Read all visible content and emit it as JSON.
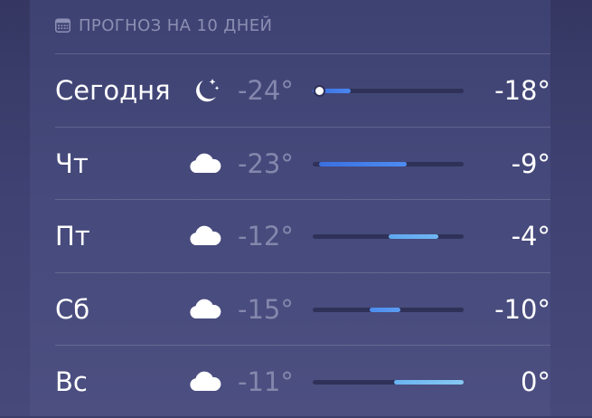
{
  "header": {
    "icon": "calendar-icon",
    "title": "ПРОГНОЗ НА 10 ДНЕЙ"
  },
  "range": {
    "min": -24,
    "max": 0
  },
  "days": [
    {
      "day": "Сегодня",
      "icon": "moon-stars-icon",
      "low": "-24°",
      "high": "-18°",
      "low_value": -24,
      "high_value": -18,
      "current_value": -24,
      "bar_color_start": "#3a6fe0",
      "bar_color_end": "#4a86f0"
    },
    {
      "day": "Чт",
      "icon": "cloud-icon",
      "low": "-23°",
      "high": "-9°",
      "low_value": -23,
      "high_value": -9,
      "bar_color_start": "#3a6fe0",
      "bar_color_end": "#4d8cf2"
    },
    {
      "day": "Пт",
      "icon": "cloud-icon",
      "low": "-12°",
      "high": "-4°",
      "low_value": -12,
      "high_value": -4,
      "bar_color_start": "#5fa8f0",
      "bar_color_end": "#6fb6f2"
    },
    {
      "day": "Сб",
      "icon": "cloud-icon",
      "low": "-15°",
      "high": "-10°",
      "low_value": -15,
      "high_value": -10,
      "bar_color_start": "#4c8cef",
      "bar_color_end": "#5b9cf1"
    },
    {
      "day": "Вс",
      "icon": "cloud-icon",
      "low": "-11°",
      "high": "0°",
      "low_value": -11,
      "high_value": 0,
      "bar_color_start": "#6ab4f2",
      "bar_color_end": "#86c8f2"
    }
  ]
}
